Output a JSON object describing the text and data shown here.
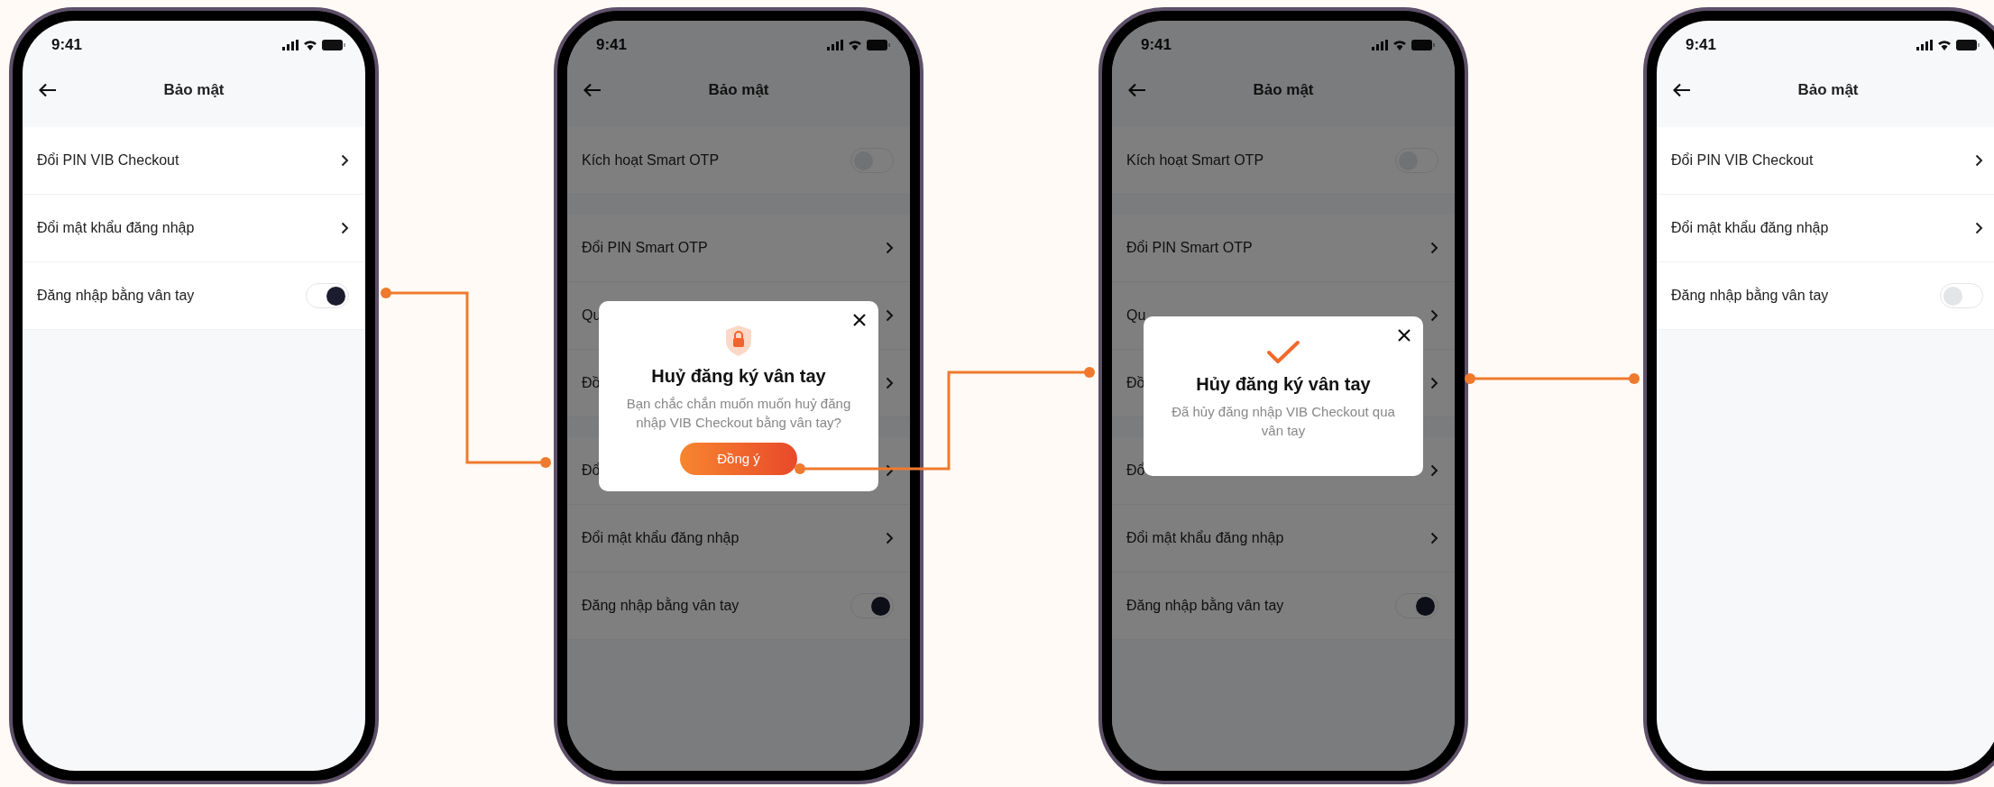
{
  "phones": [
    {
      "status_time": "9:41",
      "title": "Bảo mật",
      "dimmed": false,
      "sections": [
        {
          "rows": [
            {
              "kind": "link",
              "label": "Đổi PIN VIB Checkout"
            },
            {
              "kind": "link",
              "label": "Đổi mật khẩu đăng nhập"
            },
            {
              "kind": "toggle",
              "label": "Đăng nhập bằng vân tay",
              "on": true
            }
          ]
        }
      ]
    },
    {
      "status_time": "9:41",
      "title": "Bảo mật",
      "dimmed": true,
      "sections": [
        {
          "rows": [
            {
              "kind": "toggle",
              "label": "Kích hoạt Smart OTP",
              "on": false
            }
          ]
        },
        {
          "rows": [
            {
              "kind": "link",
              "label": "Đổi PIN Smart OTP"
            },
            {
              "kind": "link",
              "label": "Qu"
            },
            {
              "kind": "link",
              "label": "Đồ"
            }
          ]
        },
        {
          "rows": [
            {
              "kind": "link",
              "label": "Đổ"
            },
            {
              "kind": "link",
              "label": "Đổi mật khẩu đăng nhập"
            },
            {
              "kind": "toggle",
              "label": "Đăng nhập bằng vân tay",
              "on": true
            }
          ]
        }
      ],
      "dialog": {
        "kind": "confirm",
        "title": "Huỷ đăng ký vân tay",
        "message": "Bạn chắc chắn muốn muốn huỷ đăng nhập VIB Checkout bằng vân tay?",
        "button": "Đồng ý"
      }
    },
    {
      "status_time": "9:41",
      "title": "Bảo mật",
      "dimmed": true,
      "sections": [
        {
          "rows": [
            {
              "kind": "toggle",
              "label": "Kích hoạt Smart OTP",
              "on": false
            }
          ]
        },
        {
          "rows": [
            {
              "kind": "link",
              "label": "Đổi PIN Smart OTP"
            },
            {
              "kind": "link",
              "label": "Qu"
            },
            {
              "kind": "link",
              "label": "Đồ"
            }
          ]
        },
        {
          "rows": [
            {
              "kind": "link",
              "label": "Đổ"
            },
            {
              "kind": "link",
              "label": "Đổi mật khẩu đăng nhập"
            },
            {
              "kind": "toggle",
              "label": "Đăng nhập bằng vân tay",
              "on": true
            }
          ]
        }
      ],
      "dialog": {
        "kind": "success",
        "title": "Hủy đăng ký vân tay",
        "message": "Đã hủy đăng nhập VIB Checkout qua vân tay"
      }
    },
    {
      "status_time": "9:41",
      "title": "Bảo mật",
      "dimmed": false,
      "sections": [
        {
          "rows": [
            {
              "kind": "link",
              "label": "Đổi PIN VIB Checkout"
            },
            {
              "kind": "link",
              "label": "Đổi mật khẩu đăng nhập"
            },
            {
              "kind": "toggle",
              "label": "Đăng nhập bằng vân tay",
              "on": false
            }
          ]
        }
      ]
    }
  ]
}
